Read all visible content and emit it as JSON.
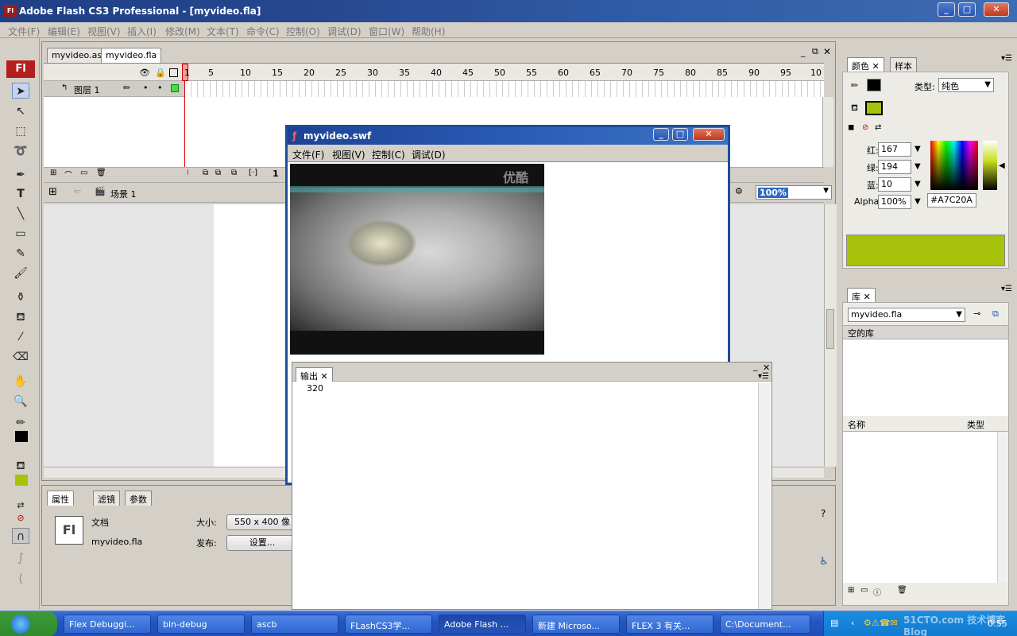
{
  "window": {
    "title": "Adobe Flash CS3 Professional - [myvideo.fla]",
    "icon": "Fl"
  },
  "menu": [
    "文件(F)",
    "编辑(E)",
    "视图(V)",
    "插入(I)",
    "修改(M)",
    "文本(T)",
    "命令(C)",
    "控制(O)",
    "调试(D)",
    "窗口(W)",
    "帮助(H)"
  ],
  "tools": {
    "logo": "Fl"
  },
  "doc_tabs": [
    "myvideo.as",
    "myvideo.fla"
  ],
  "timeline": {
    "frame_numbers": [
      "1",
      "5",
      "10",
      "15",
      "20",
      "25",
      "30",
      "35",
      "40",
      "45",
      "50",
      "55",
      "60",
      "65",
      "70",
      "75",
      "80",
      "85",
      "90",
      "95",
      "10"
    ],
    "layer_name": "图层 1",
    "current_frame": "1"
  },
  "scene": {
    "label": "场景 1",
    "zoom": "100%"
  },
  "swf_window": {
    "title": "myvideo.swf",
    "menu": [
      "文件(F)",
      "视图(V)",
      "控制(C)",
      "调试(D)"
    ],
    "video_watermark": "优酷"
  },
  "output_panel": {
    "tab": "输出",
    "text": "320"
  },
  "properties": {
    "tabs": [
      "属性",
      "滤镜",
      "参数"
    ],
    "doc_label": "文档",
    "doc_name": "myvideo.fla",
    "size_label": "大小:",
    "size_value": "550 x 400 像",
    "publish_label": "发布:",
    "settings_button": "设置..."
  },
  "color_panel": {
    "tabs": [
      "颜色",
      "样本"
    ],
    "type_label": "类型:",
    "type_value": "纯色",
    "red_label": "红:",
    "red": "167",
    "green_label": "绿:",
    "green": "194",
    "blue_label": "蓝:",
    "blue": "10",
    "alpha_label": "Alpha:",
    "alpha": "100%",
    "hex": "#A7C20A",
    "fill_color": "#A7C20A"
  },
  "library_panel": {
    "tab": "库",
    "doc": "myvideo.fla",
    "empty": "空的库",
    "col_name": "名称",
    "col_type": "类型"
  },
  "taskbar": {
    "items": [
      "Flex Debuggi...",
      "bin-debug",
      "ascb",
      "FLashCS3学...",
      "Adobe Flash ...",
      "新建 Microso...",
      "FLEX 3 有关...",
      "C:\\Document..."
    ],
    "clock": "0:55",
    "watermark": "51CTO.com 技术博客 Blog"
  }
}
